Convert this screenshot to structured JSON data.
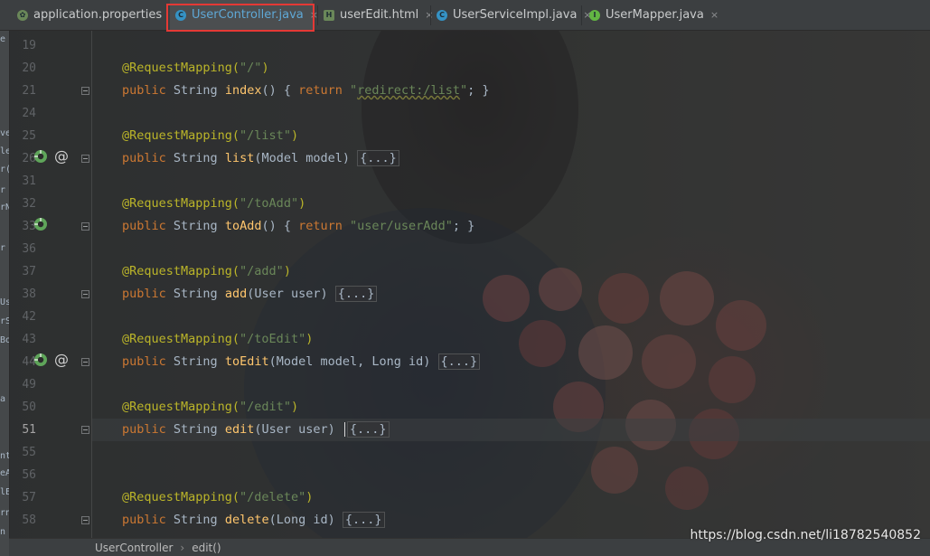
{
  "tabs": [
    {
      "label": "application.properties",
      "icon": "spring-leaf-icon",
      "color": "#6a8759",
      "active": false
    },
    {
      "label": "UserController.java",
      "icon": "class-icon",
      "color": "#3592c4",
      "active": true
    },
    {
      "label": "userEdit.html",
      "icon": "html-file-icon",
      "color": "#6a8759",
      "active": false
    },
    {
      "label": "UserServiceImpl.java",
      "icon": "class-icon",
      "color": "#3592c4",
      "active": false
    },
    {
      "label": "UserMapper.java",
      "icon": "interface-icon",
      "color": "#62b543",
      "active": false
    }
  ],
  "tab_close_glyph": "×",
  "highlight_color": "#e53935",
  "left_strip_chars": [
    "e",
    "ve",
    "le",
    "r(",
    "r",
    "rN",
    "r",
    "Us",
    "rS",
    "Bo",
    "a",
    "nti",
    "eA",
    "lE",
    "rn",
    "n"
  ],
  "line_numbers": [
    "19",
    "20",
    "21",
    "24",
    "25",
    "26",
    "31",
    "32",
    "33",
    "36",
    "37",
    "38",
    "42",
    "43",
    "44",
    "49",
    "50",
    "51",
    "55",
    "56",
    "57",
    "58"
  ],
  "current_line": "51",
  "code": {
    "l20": {
      "ann": "@RequestMapping(",
      "str": "\"/\"",
      "close": ")"
    },
    "l21": {
      "kw": "public",
      "type": " String ",
      "fn": "index",
      "paren": "()",
      "body_open": " { ",
      "kw2": "return",
      "space": " ",
      "str_q1": "\"",
      "str_link": "redirect:/list",
      "str_q2": "\"",
      "semi": "; }"
    },
    "l25": {
      "ann": "@RequestMapping(",
      "str": "\"/list\"",
      "close": ")"
    },
    "l26": {
      "kw": "public",
      "type": " String ",
      "fn": "list",
      "params": "(Model model) ",
      "fold": "{...}"
    },
    "l32": {
      "ann": "@RequestMapping(",
      "str": "\"/toAdd\"",
      "close": ")"
    },
    "l33": {
      "kw": "public",
      "type": " String ",
      "fn": "toAdd",
      "paren": "()",
      "body_open": " { ",
      "kw2": "return",
      "space": " ",
      "str": "\"user/userAdd\"",
      "semi": "; }"
    },
    "l37": {
      "ann": "@RequestMapping(",
      "str": "\"/add\"",
      "close": ")"
    },
    "l38": {
      "kw": "public",
      "type": " String ",
      "fn": "add",
      "params": "(User user) ",
      "fold": "{...}"
    },
    "l43": {
      "ann": "@RequestMapping(",
      "str": "\"/toEdit\"",
      "close": ")"
    },
    "l44": {
      "kw": "public",
      "type": " String ",
      "fn": "toEdit",
      "params": "(Model model, Long id) ",
      "fold": "{...}"
    },
    "l50": {
      "ann": "@RequestMapping(",
      "str": "\"/edit\"",
      "close": ")"
    },
    "l51": {
      "kw": "public",
      "type": " String ",
      "fn": "edit",
      "params": "(User user) ",
      "fold": "{...}"
    },
    "l57": {
      "ann": "@RequestMapping(",
      "str": "\"/delete\"",
      "close": ")"
    },
    "l58": {
      "kw": "public",
      "type": " String ",
      "fn": "delete",
      "params": "(Long id) ",
      "fold": "{...}"
    }
  },
  "breadcrumb": {
    "class": "UserController",
    "sep": "›",
    "method": "edit()"
  },
  "watermark": "https://blog.csdn.net/li18782540852",
  "colors": {
    "keyword": "#cc7832",
    "annotation": "#bbb529",
    "string": "#6a8759",
    "method": "#ffc66d",
    "text": "#a9b7c6"
  }
}
